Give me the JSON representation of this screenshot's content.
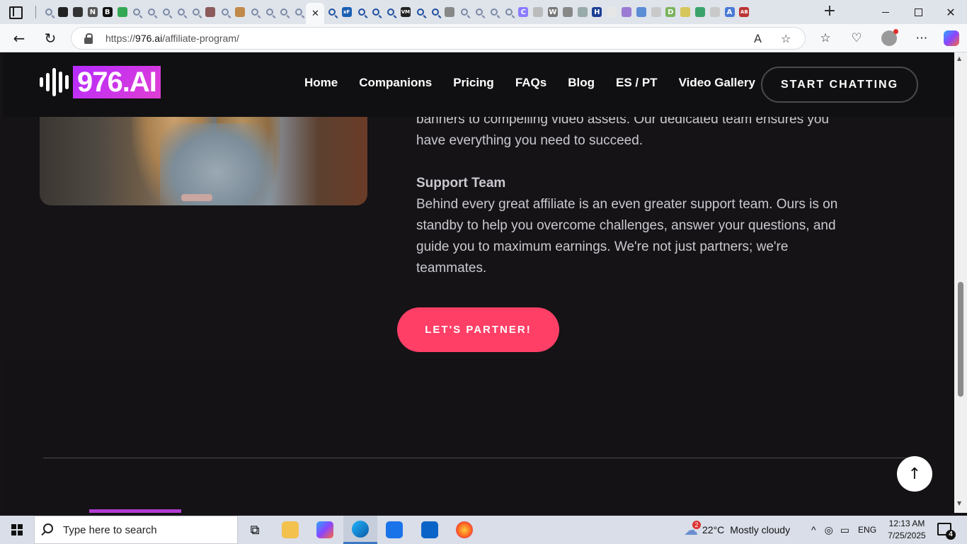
{
  "browser": {
    "tab_favicons": [
      "search-icon",
      "openai-icon",
      "astra-icon",
      "notion-icon",
      "b-icon",
      "maps-icon",
      "search-icon",
      "search-icon",
      "search-icon",
      "search-icon",
      "search-icon",
      "image-icon",
      "search-icon",
      "cookie-icon",
      "search-icon",
      "search-icon",
      "search-icon",
      "search-icon",
      "active-tab",
      "search-icon",
      "xf-icon",
      "search-icon",
      "search-icon",
      "search-icon",
      "vm-icon",
      "search-icon",
      "search-icon",
      "globe-icon",
      "search-icon",
      "search-icon",
      "search-icon",
      "search-icon",
      "c-icon",
      "circle-icon",
      "w-icon",
      "globe-icon",
      "figure-icon",
      "h-icon",
      "blank-icon",
      "purple-icon",
      "b-italic-icon",
      "doc-icon",
      "d-icon",
      "zm-icon",
      "mail-icon",
      "page-icon",
      "ab-icon",
      "ab-red-icon"
    ],
    "url_scheme": "https://",
    "url_host": "976.ai",
    "url_path": "/affiliate-program/"
  },
  "site": {
    "logo_text": "976.AI",
    "nav": [
      {
        "label": "Home"
      },
      {
        "label": "Companions"
      },
      {
        "label": "Pricing"
      },
      {
        "label": "FAQs"
      },
      {
        "label": "Blog"
      },
      {
        "label": "ES / PT"
      },
      {
        "label": "Video Gallery"
      }
    ],
    "cta_label": "START CHATTING",
    "intro_text": "banners to compelling video assets. Our dedicated team ensures you have everything you need to succeed.",
    "support_heading": "Support Team",
    "support_text": "Behind every great affiliate is an even greater support team. Ours is on standby to help you overcome challenges, answer your questions, and guide you to maximum earnings. We're not just partners; we're teammates.",
    "partner_button": "LET'S PARTNER!",
    "scroll_top_icon": "arrow-up-icon",
    "colors": {
      "accent": "#ff3f66",
      "logo_gradient_start": "#b52bff",
      "logo_gradient_end": "#e03fd3",
      "background": "#151316"
    }
  },
  "taskbar": {
    "search_placeholder": "Type here to search",
    "weather_badge": "2",
    "weather_temp": "22°C",
    "weather_text": "Mostly cloudy",
    "language": "ENG",
    "time": "12:13 AM",
    "date": "7/25/2025",
    "notification_count": "4"
  }
}
